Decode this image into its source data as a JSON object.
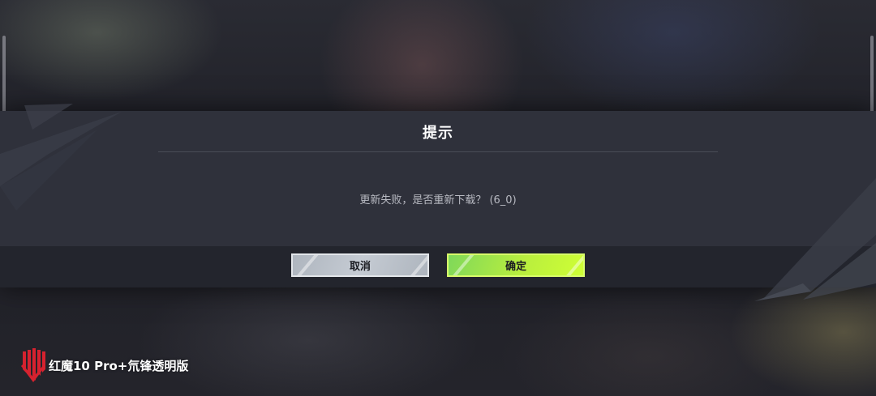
{
  "dialog": {
    "title": "提示",
    "message": "更新失败，是否重新下载？ (6_0)",
    "cancel_label": "取消",
    "confirm_label": "确定"
  },
  "watermark": {
    "text": "红魔10 Pro+氘锋透明版",
    "icon": "redmagic-logo-icon"
  },
  "colors": {
    "dialog_bg": "#2f313b",
    "cancel_button": "#b9bfc8",
    "confirm_button": "#b9ee3e",
    "logo_red": "#d6222f"
  }
}
